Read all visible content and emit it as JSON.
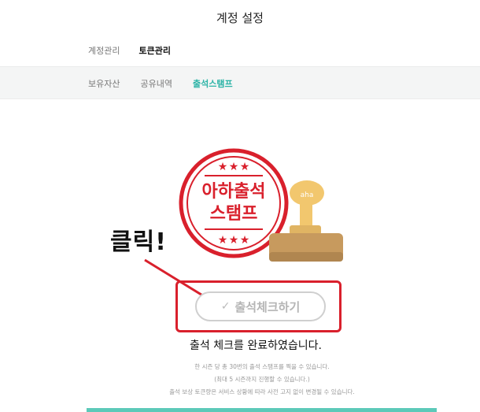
{
  "header": {
    "title": "계정 설정"
  },
  "primary_tabs": [
    {
      "label": "계정관리",
      "active": false
    },
    {
      "label": "토큰관리",
      "active": true
    }
  ],
  "sub_tabs": [
    {
      "label": "보유자산",
      "active": false
    },
    {
      "label": "공유내역",
      "active": false
    },
    {
      "label": "출석스탬프",
      "active": true
    }
  ],
  "stamp": {
    "line1": "아하출석",
    "line2": "스탬프",
    "logo_text": "aha",
    "colors": {
      "red": "#d9202c",
      "stamp_gold": "#f2c76e",
      "stamp_base": "#c79a5e"
    }
  },
  "annotation": {
    "text": "클릭!",
    "color": "#d9202c"
  },
  "checkin": {
    "button_label": "출석체크하기",
    "check_icon": "check-icon"
  },
  "status": {
    "message": "출석 체크를 완료하였습니다."
  },
  "notes": [
    "한 시즌 당 총 30번의 출석 스탬프를 찍을 수 있습니다.",
    "(최대 5 시즌까지 진행할 수 있습니다.)",
    "출석 보상 토큰량은 서비스 상황에 따라 사전 고지 없이 변경될 수 있습니다."
  ],
  "colors": {
    "accent": "#2bb3a6",
    "bottom_bar": "#5cc9b9"
  }
}
